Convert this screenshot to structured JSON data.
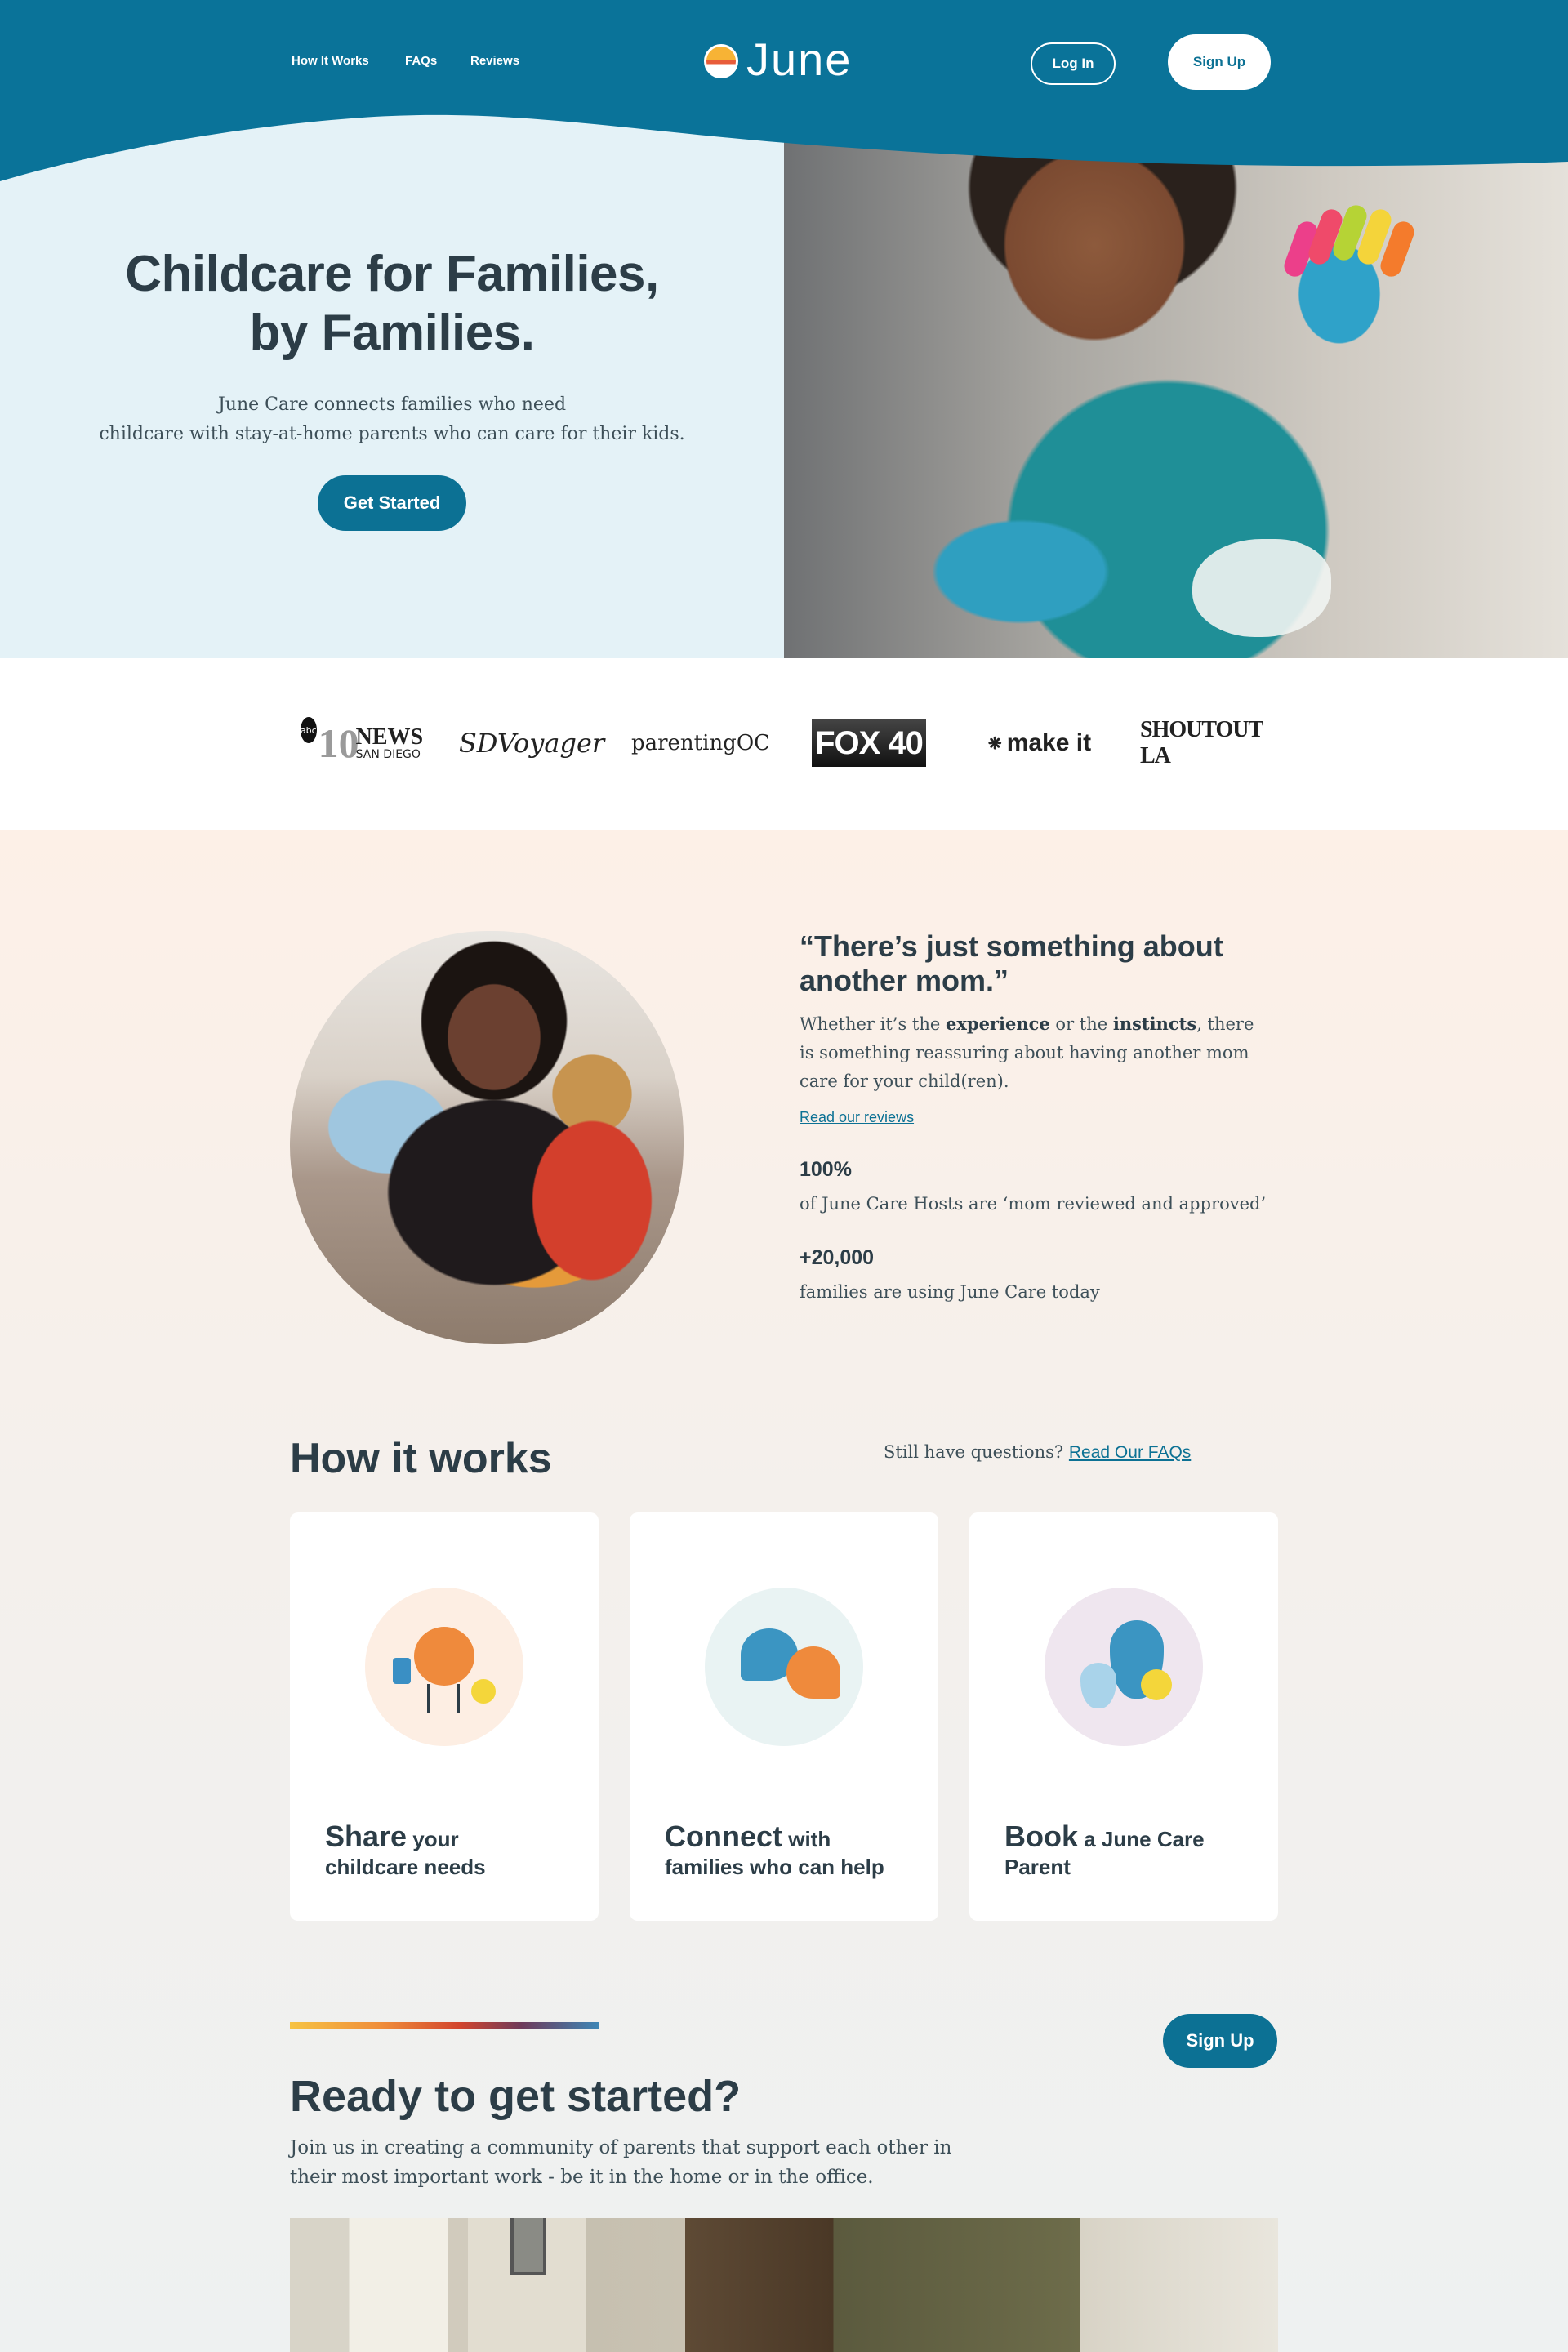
{
  "brand": {
    "name": "June",
    "colors": {
      "primary": "#0c7194",
      "text": "#2c3d47",
      "hero_bg": "#e4f2f7",
      "cream": "#fdf0e7"
    }
  },
  "nav": {
    "links": [
      "How It Works",
      "FAQs",
      "Reviews"
    ],
    "login": "Log In",
    "signup": "Sign Up"
  },
  "hero": {
    "title_line1": "Childcare for Families,",
    "title_line2": "by Families.",
    "subtitle_line1": "June Care connects families who need",
    "subtitle_line2": "childcare with stay-at-home parents who can care for their kids.",
    "cta": "Get Started",
    "image": "smiling child with painted hands"
  },
  "press": {
    "abc_badge": "abc",
    "abc_number": "10",
    "abc_news": "NEWS",
    "abc_city": "SAN DIEGO",
    "sdvoyager": "SDVoyager",
    "parenting": "parentingOC",
    "fox": "FOX 40",
    "makeit": "make it",
    "shoutout": "SHOUTOUT LA"
  },
  "testimonial": {
    "title": "“There’s just something about another mom.”",
    "body_pre": "Whether it’s the ",
    "body_bold1": "experience",
    "body_mid": " or the ",
    "body_bold2": "instincts",
    "body_post": ", there is something reassuring about having another mom care for your child(ren).",
    "link": "Read our reviews",
    "stats": [
      {
        "value": "100%",
        "label": "of June Care Hosts are ‘mom reviewed and approved’"
      },
      {
        "value": "+20,000",
        "label": "families are using June Care today"
      }
    ]
  },
  "how": {
    "title": "How it works",
    "question": "Still have questions?",
    "faq_link": "Read Our FAQs",
    "cards": [
      {
        "big": "Share",
        "rest1": " your",
        "rest2": "childcare needs",
        "circle_color": "#fdeee3"
      },
      {
        "big": "Connect",
        "rest1": " with",
        "rest2": "families who can help",
        "circle_color": "#e9f3f3"
      },
      {
        "big": "Book",
        "rest1": " a June Care",
        "rest2": "Parent",
        "circle_color": "#efe6ef"
      }
    ]
  },
  "ready": {
    "title": "Ready to get started?",
    "text": "Join us in creating a community of parents that support each other in their most important work - be it in the home or in the office.",
    "signup": "Sign Up"
  }
}
